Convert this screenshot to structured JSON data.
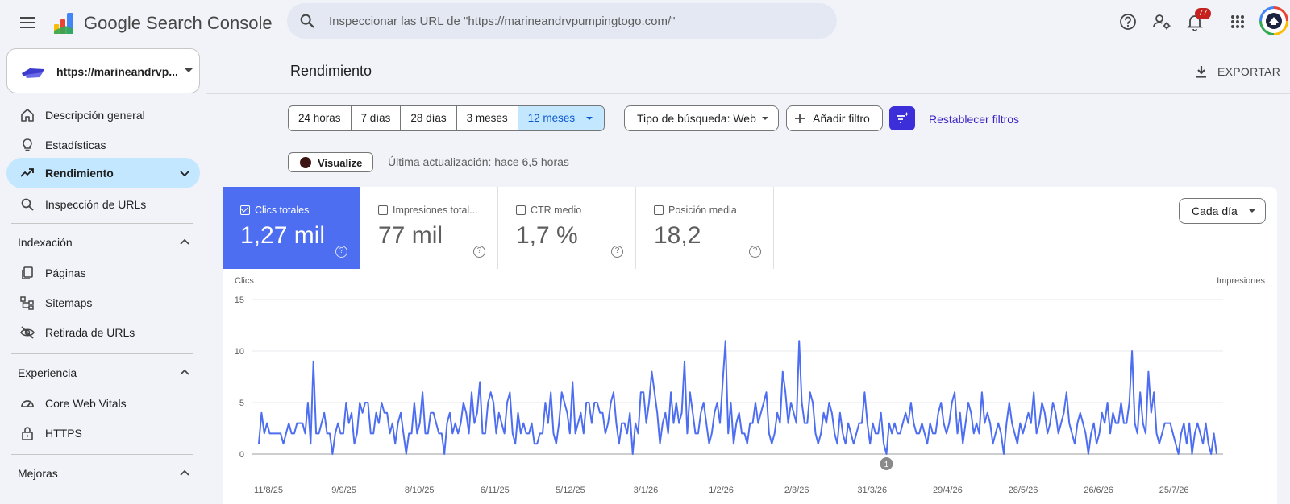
{
  "app": {
    "brand": "Google Search Console",
    "search_placeholder": "Inspeccionar las URL de \"https://marineandrvpumpingtogo.com/\"",
    "notification_count": "77"
  },
  "sidebar": {
    "property_label": "https://marineandrvp...",
    "items": [
      {
        "label": "Descripción general",
        "icon": "home-icon"
      },
      {
        "label": "Estadísticas",
        "icon": "lightbulb-icon"
      },
      {
        "label": "Rendimiento",
        "icon": "trending-up-icon",
        "active": true
      },
      {
        "label": "Inspección de URLs",
        "icon": "search-icon"
      }
    ],
    "sections": [
      {
        "title": "Indexación",
        "items": [
          {
            "label": "Páginas",
            "icon": "pages-icon"
          },
          {
            "label": "Sitemaps",
            "icon": "sitemap-icon"
          },
          {
            "label": "Retirada de URLs",
            "icon": "eye-off-icon"
          }
        ]
      },
      {
        "title": "Experiencia",
        "items": [
          {
            "label": "Core Web Vitals",
            "icon": "gauge-icon"
          },
          {
            "label": "HTTPS",
            "icon": "lock-icon"
          }
        ]
      },
      {
        "title": "Mejoras",
        "items": []
      }
    ]
  },
  "main": {
    "title": "Rendimiento",
    "export_label": "EXPORTAR",
    "date_ranges": [
      "24 horas",
      "7 días",
      "28 días",
      "3 meses",
      "12 meses"
    ],
    "selected_range": "12 meses",
    "search_type": "Tipo de búsqueda: Web",
    "add_filter": "Añadir filtro",
    "reset_filters": "Restablecer filtros",
    "visualize": "Visualize",
    "last_update": "Última actualización: hace 6,5 horas",
    "granularity": "Cada día",
    "metrics": [
      {
        "label": "Clics totales",
        "value": "1,27 mil",
        "checked": true
      },
      {
        "label": "Impresiones total...",
        "value": "77 mil",
        "checked": false
      },
      {
        "label": "CTR medio",
        "value": "1,7 %",
        "checked": false
      },
      {
        "label": "Posición media",
        "value": "18,2",
        "checked": false
      }
    ]
  },
  "colors": {
    "accent": "#4e6ef2",
    "selection": "#c2e7ff",
    "link": "#3a1fc4",
    "line": "#4e6ef2"
  },
  "chart_data": {
    "type": "line",
    "ylabel": "Clics",
    "y2label": "Impresiones",
    "ylim": [
      0,
      15
    ],
    "yticks": [
      0,
      5,
      10,
      15
    ],
    "xticks": [
      "11/8/25",
      "9/9/25",
      "8/10/25",
      "6/11/25",
      "5/12/25",
      "3/1/26",
      "1/2/26",
      "2/3/26",
      "31/3/26",
      "29/4/26",
      "28/5/26",
      "26/6/26",
      "25/7/26"
    ],
    "annotation": {
      "label": "1",
      "x_index": 230
    },
    "series": [
      {
        "values": [
          1,
          4,
          2,
          3,
          2,
          2,
          2,
          2,
          2,
          1,
          2,
          3,
          2,
          2,
          3,
          3,
          3,
          2,
          5,
          1,
          9,
          2,
          2,
          3,
          4,
          2,
          2,
          0,
          2,
          3,
          2,
          2,
          5,
          3,
          4,
          1,
          2,
          5,
          4,
          5,
          5,
          2,
          2,
          4,
          3,
          5,
          4,
          4,
          2,
          3,
          1,
          3,
          4,
          2,
          0,
          2,
          2,
          5,
          2,
          3,
          6,
          2,
          2,
          4,
          4,
          3,
          2,
          2,
          0,
          3,
          4,
          2,
          3,
          2,
          3,
          5,
          4,
          2,
          6,
          3,
          4,
          7,
          2,
          2,
          5,
          6,
          5,
          2,
          4,
          3,
          2,
          5,
          6,
          2,
          1,
          4,
          2,
          3,
          2,
          2,
          3,
          1,
          1,
          2,
          2,
          5,
          3,
          6,
          2,
          1,
          3,
          6,
          5,
          4,
          2,
          7,
          2,
          3,
          4,
          2,
          5,
          5,
          3,
          5,
          5,
          4,
          4,
          2,
          3,
          5,
          6,
          3,
          1,
          3,
          3,
          2,
          4,
          0,
          3,
          2,
          6,
          6,
          3,
          5,
          8,
          6,
          4,
          1,
          3,
          4,
          2,
          6,
          3,
          5,
          3,
          4,
          9,
          2,
          6,
          4,
          2,
          2,
          4,
          5,
          3,
          1,
          2,
          4,
          5,
          3,
          7,
          11,
          2,
          5,
          1,
          3,
          4,
          2,
          2,
          1,
          3,
          3,
          5,
          3,
          4,
          5,
          6,
          2,
          1,
          2,
          4,
          3,
          8,
          6,
          3,
          5,
          4,
          3,
          11,
          5,
          3,
          3,
          6,
          5,
          2,
          1,
          2,
          4,
          3,
          5,
          4,
          2,
          1,
          4,
          2,
          1,
          3,
          2,
          1,
          2,
          3,
          3,
          6,
          3,
          1,
          3,
          2,
          2,
          4,
          1,
          0,
          3,
          2,
          3,
          2,
          2,
          3,
          4,
          3,
          5,
          3,
          2,
          2,
          3,
          2,
          1,
          3,
          2,
          2,
          4,
          5,
          3,
          2,
          3,
          5,
          6,
          2,
          4,
          1,
          3,
          5,
          4,
          2,
          3,
          2,
          6,
          3,
          4,
          3,
          1,
          2,
          3,
          2,
          0,
          3,
          5,
          3,
          2,
          1,
          3,
          2,
          3,
          4,
          3,
          6,
          2,
          3,
          5,
          4,
          2,
          3,
          5,
          4,
          2,
          3,
          4,
          6,
          3,
          2,
          1,
          3,
          4,
          3,
          2,
          0,
          2,
          3,
          1,
          2,
          4,
          3,
          5,
          2,
          4,
          3,
          3,
          5,
          3,
          3,
          5,
          10,
          3,
          2,
          6,
          3,
          2,
          8,
          4,
          6,
          2,
          1,
          2,
          3,
          3,
          3,
          2,
          1,
          0,
          2,
          3,
          1,
          3,
          0,
          2,
          3,
          2,
          1,
          3,
          1,
          0,
          2,
          0
        ]
      }
    ]
  }
}
